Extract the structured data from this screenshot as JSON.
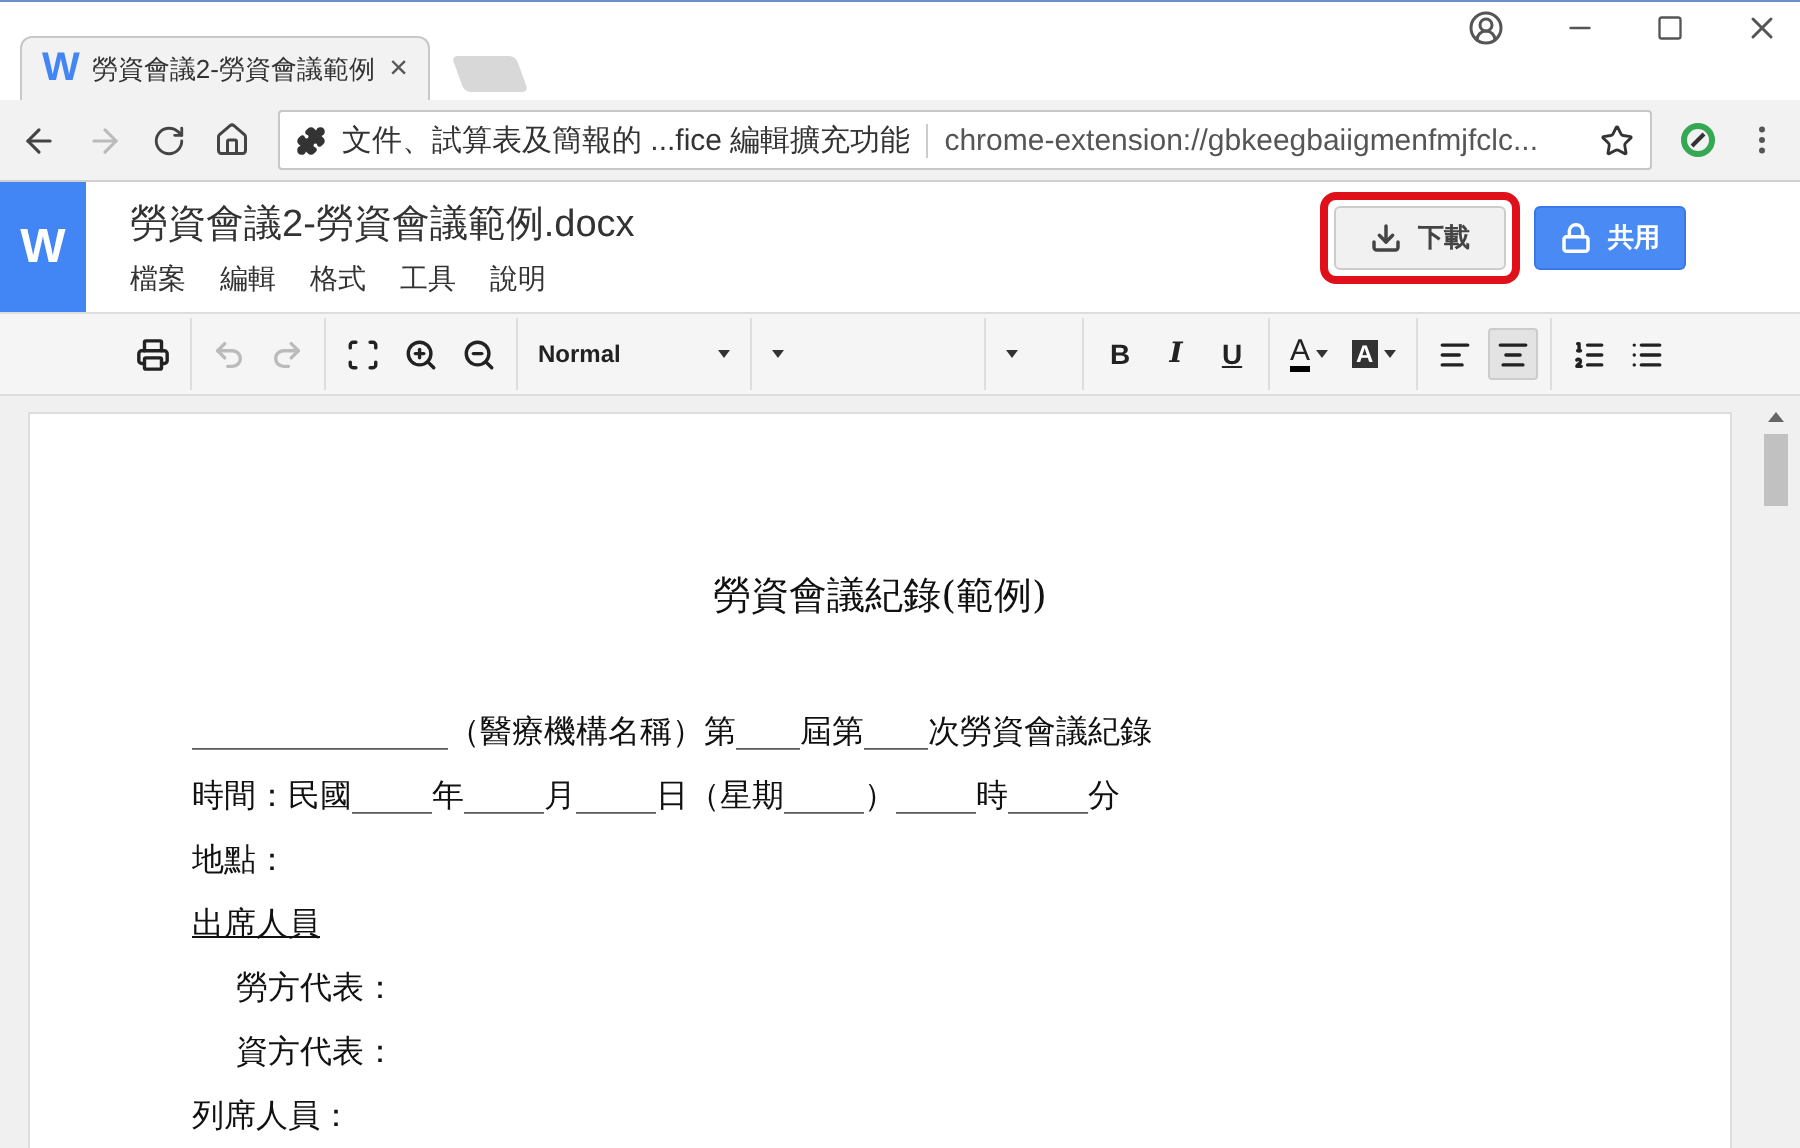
{
  "browser": {
    "tabs": [
      {
        "title": "勞資會議2-勞資會議範例",
        "favicon": "W",
        "close": "×",
        "selected": true
      }
    ],
    "address": {
      "extension_name": "文件、試算表及簡報的 ...fice 編輯擴充功能",
      "url": "chrome-extension://gbkeegbaiigmenfmjfclc..."
    }
  },
  "app": {
    "logo": "W",
    "doc_title": "勞資會議2-勞資會議範例.docx",
    "menu": [
      "檔案",
      "編輯",
      "格式",
      "工具",
      "說明"
    ],
    "buttons": [
      {
        "kind": "download",
        "label": "下載",
        "highlighted": true
      },
      {
        "kind": "share",
        "label": "共用",
        "highlighted": false
      }
    ]
  },
  "toolbar": [
    {
      "kind": "print",
      "disabled": false
    },
    {
      "kind": "sep"
    },
    {
      "kind": "undo",
      "disabled": true
    },
    {
      "kind": "redo",
      "disabled": true
    },
    {
      "kind": "sep"
    },
    {
      "kind": "fit",
      "disabled": false
    },
    {
      "kind": "zoom_in",
      "disabled": false
    },
    {
      "kind": "zoom_out",
      "disabled": false
    },
    {
      "kind": "sep"
    },
    {
      "kind": "style_select",
      "label": "Normal"
    },
    {
      "kind": "sep"
    },
    {
      "kind": "font_select"
    },
    {
      "kind": "sep"
    },
    {
      "kind": "size_select"
    },
    {
      "kind": "sep"
    },
    {
      "kind": "bold",
      "label": "B"
    },
    {
      "kind": "italic",
      "label": "I"
    },
    {
      "kind": "underline",
      "label": "U"
    },
    {
      "kind": "sep"
    },
    {
      "kind": "text_color",
      "label": "A",
      "color": "#000000"
    },
    {
      "kind": "highlight",
      "label": "A"
    },
    {
      "kind": "sep"
    },
    {
      "kind": "align_left",
      "selected": false
    },
    {
      "kind": "align_center",
      "selected": true
    },
    {
      "kind": "sep"
    },
    {
      "kind": "numbered_list"
    },
    {
      "kind": "bulleted_list"
    }
  ],
  "document": [
    {
      "kind": "title",
      "text": "勞資會議紀錄(範例)"
    },
    {
      "kind": "line",
      "text": "________________（醫療機構名稱）第____屆第____次勞資會議紀錄"
    },
    {
      "kind": "line",
      "text": "時間：民國_____年_____月_____日（星期_____）_____時_____分"
    },
    {
      "kind": "line",
      "text": "地點："
    },
    {
      "kind": "heading",
      "text": "出席人員"
    },
    {
      "kind": "indent",
      "text": "勞方代表："
    },
    {
      "kind": "indent",
      "text": "資方代表："
    },
    {
      "kind": "line",
      "text": "列席人員："
    }
  ]
}
